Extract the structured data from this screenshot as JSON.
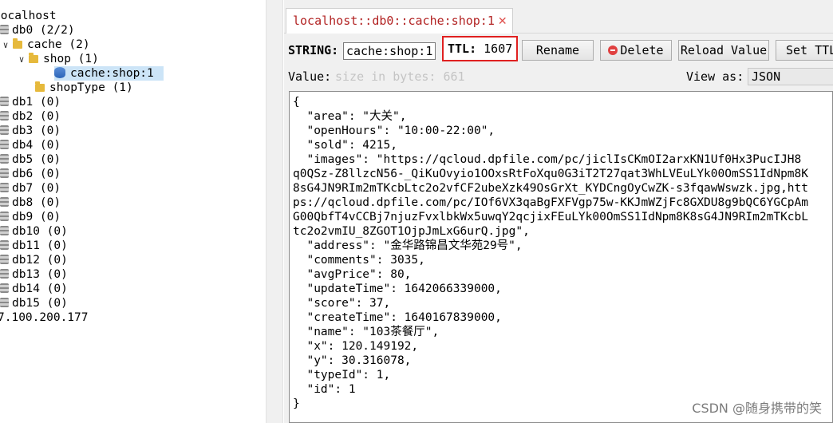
{
  "tree": {
    "server_top": "localhost",
    "db0_label": "db0  (2/2)",
    "cache_folder": "cache  (2)",
    "shop_folder": "shop  (1)",
    "selected_key": "cache:shop:1",
    "shoptype_folder": "shopType  (1)",
    "dbs": [
      "db1  (0)",
      "db2  (0)",
      "db3  (0)",
      "db4  (0)",
      "db5  (0)",
      "db6  (0)",
      "db7  (0)",
      "db8  (0)",
      "db9  (0)",
      "db10  (0)",
      "db11  (0)",
      "db12  (0)",
      "db13  (0)",
      "db14  (0)",
      "db15  (0)"
    ],
    "server_bottom": "7.100.200.177"
  },
  "tab": {
    "title": "localhost::db0::cache:shop:1",
    "close": "✕"
  },
  "toolbar": {
    "type_label": "STRING:",
    "key_value": "cache:shop:1",
    "ttl_label": "TTL:",
    "ttl_value": "1607",
    "rename": "Rename",
    "delete": "Delete",
    "reload": "Reload Value",
    "set_ttl": "Set TTL"
  },
  "value": {
    "label": "Value:",
    "size_hint": "size in bytes: 661",
    "view_as_label": "View as:",
    "view_as_value": "JSON"
  },
  "json_lines": [
    "{",
    "  \"area\": \"大关\",",
    "  \"openHours\": \"10:00-22:00\",",
    "  \"sold\": 4215,",
    "  \"images\": \"https://qcloud.dpfile.com/pc/jiclIsCKmOI2arxKN1Uf0Hx3PucIJH8q0QSz-Z8llzcN56-_QiKuOvyio1OOxsRtFoXqu0G3iT2T27qat3WhLVEuLYk00OmSS1IdNpm8K8sG4JN9RIm2mTKcbLtc2o2vfCF2ubeXzk49OsGrXt_KYDCngOyCwZK-s3fqawWswzk.jpg,https://qcloud.dpfile.com/pc/IOf6VX3qaBgFXFVgp75w-KKJmWZjFc8GXDU8g9bQC6YGCpAmG00QbfT4vCCBj7njuzFvxlbkWx5uwqY2qcjixFEuLYk00OmSS1IdNpm8K8sG4JN9RIm2mTKcbLtc2o2vmIU_8ZGOT1OjpJmLxG6urQ.jpg\",",
    "  \"address\": \"金华路锦昌文华苑29号\",",
    "  \"comments\": 3035,",
    "  \"avgPrice\": 80,",
    "  \"updateTime\": 1642066339000,",
    "  \"score\": 37,",
    "  \"createTime\": 1640167839000,",
    "  \"name\": \"103茶餐厅\",",
    "  \"x\": 120.149192,",
    "  \"y\": 30.316078,",
    "  \"typeId\": 1,",
    "  \"id\": 1",
    "}"
  ],
  "watermark": "CSDN @随身携带的笑"
}
